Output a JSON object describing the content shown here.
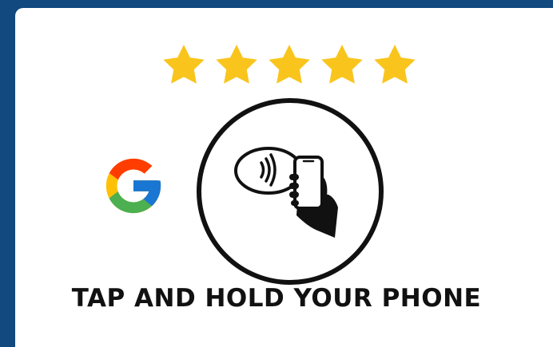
{
  "rating": {
    "value": 5,
    "max": 5,
    "star_color": "#f9c51d"
  },
  "brand": {
    "icon": "google-icon",
    "colors": {
      "blue": "#4285F4",
      "red": "#EA4335",
      "yellow": "#FBBC05",
      "green": "#34A853"
    }
  },
  "tap_graphic": {
    "icon": "phone-tap-nfc-icon"
  },
  "caption": {
    "text": "TAP AND HOLD YOUR PHONE"
  },
  "colors": {
    "background": "#12497f",
    "card": "#ffffff",
    "ink": "#111111"
  }
}
